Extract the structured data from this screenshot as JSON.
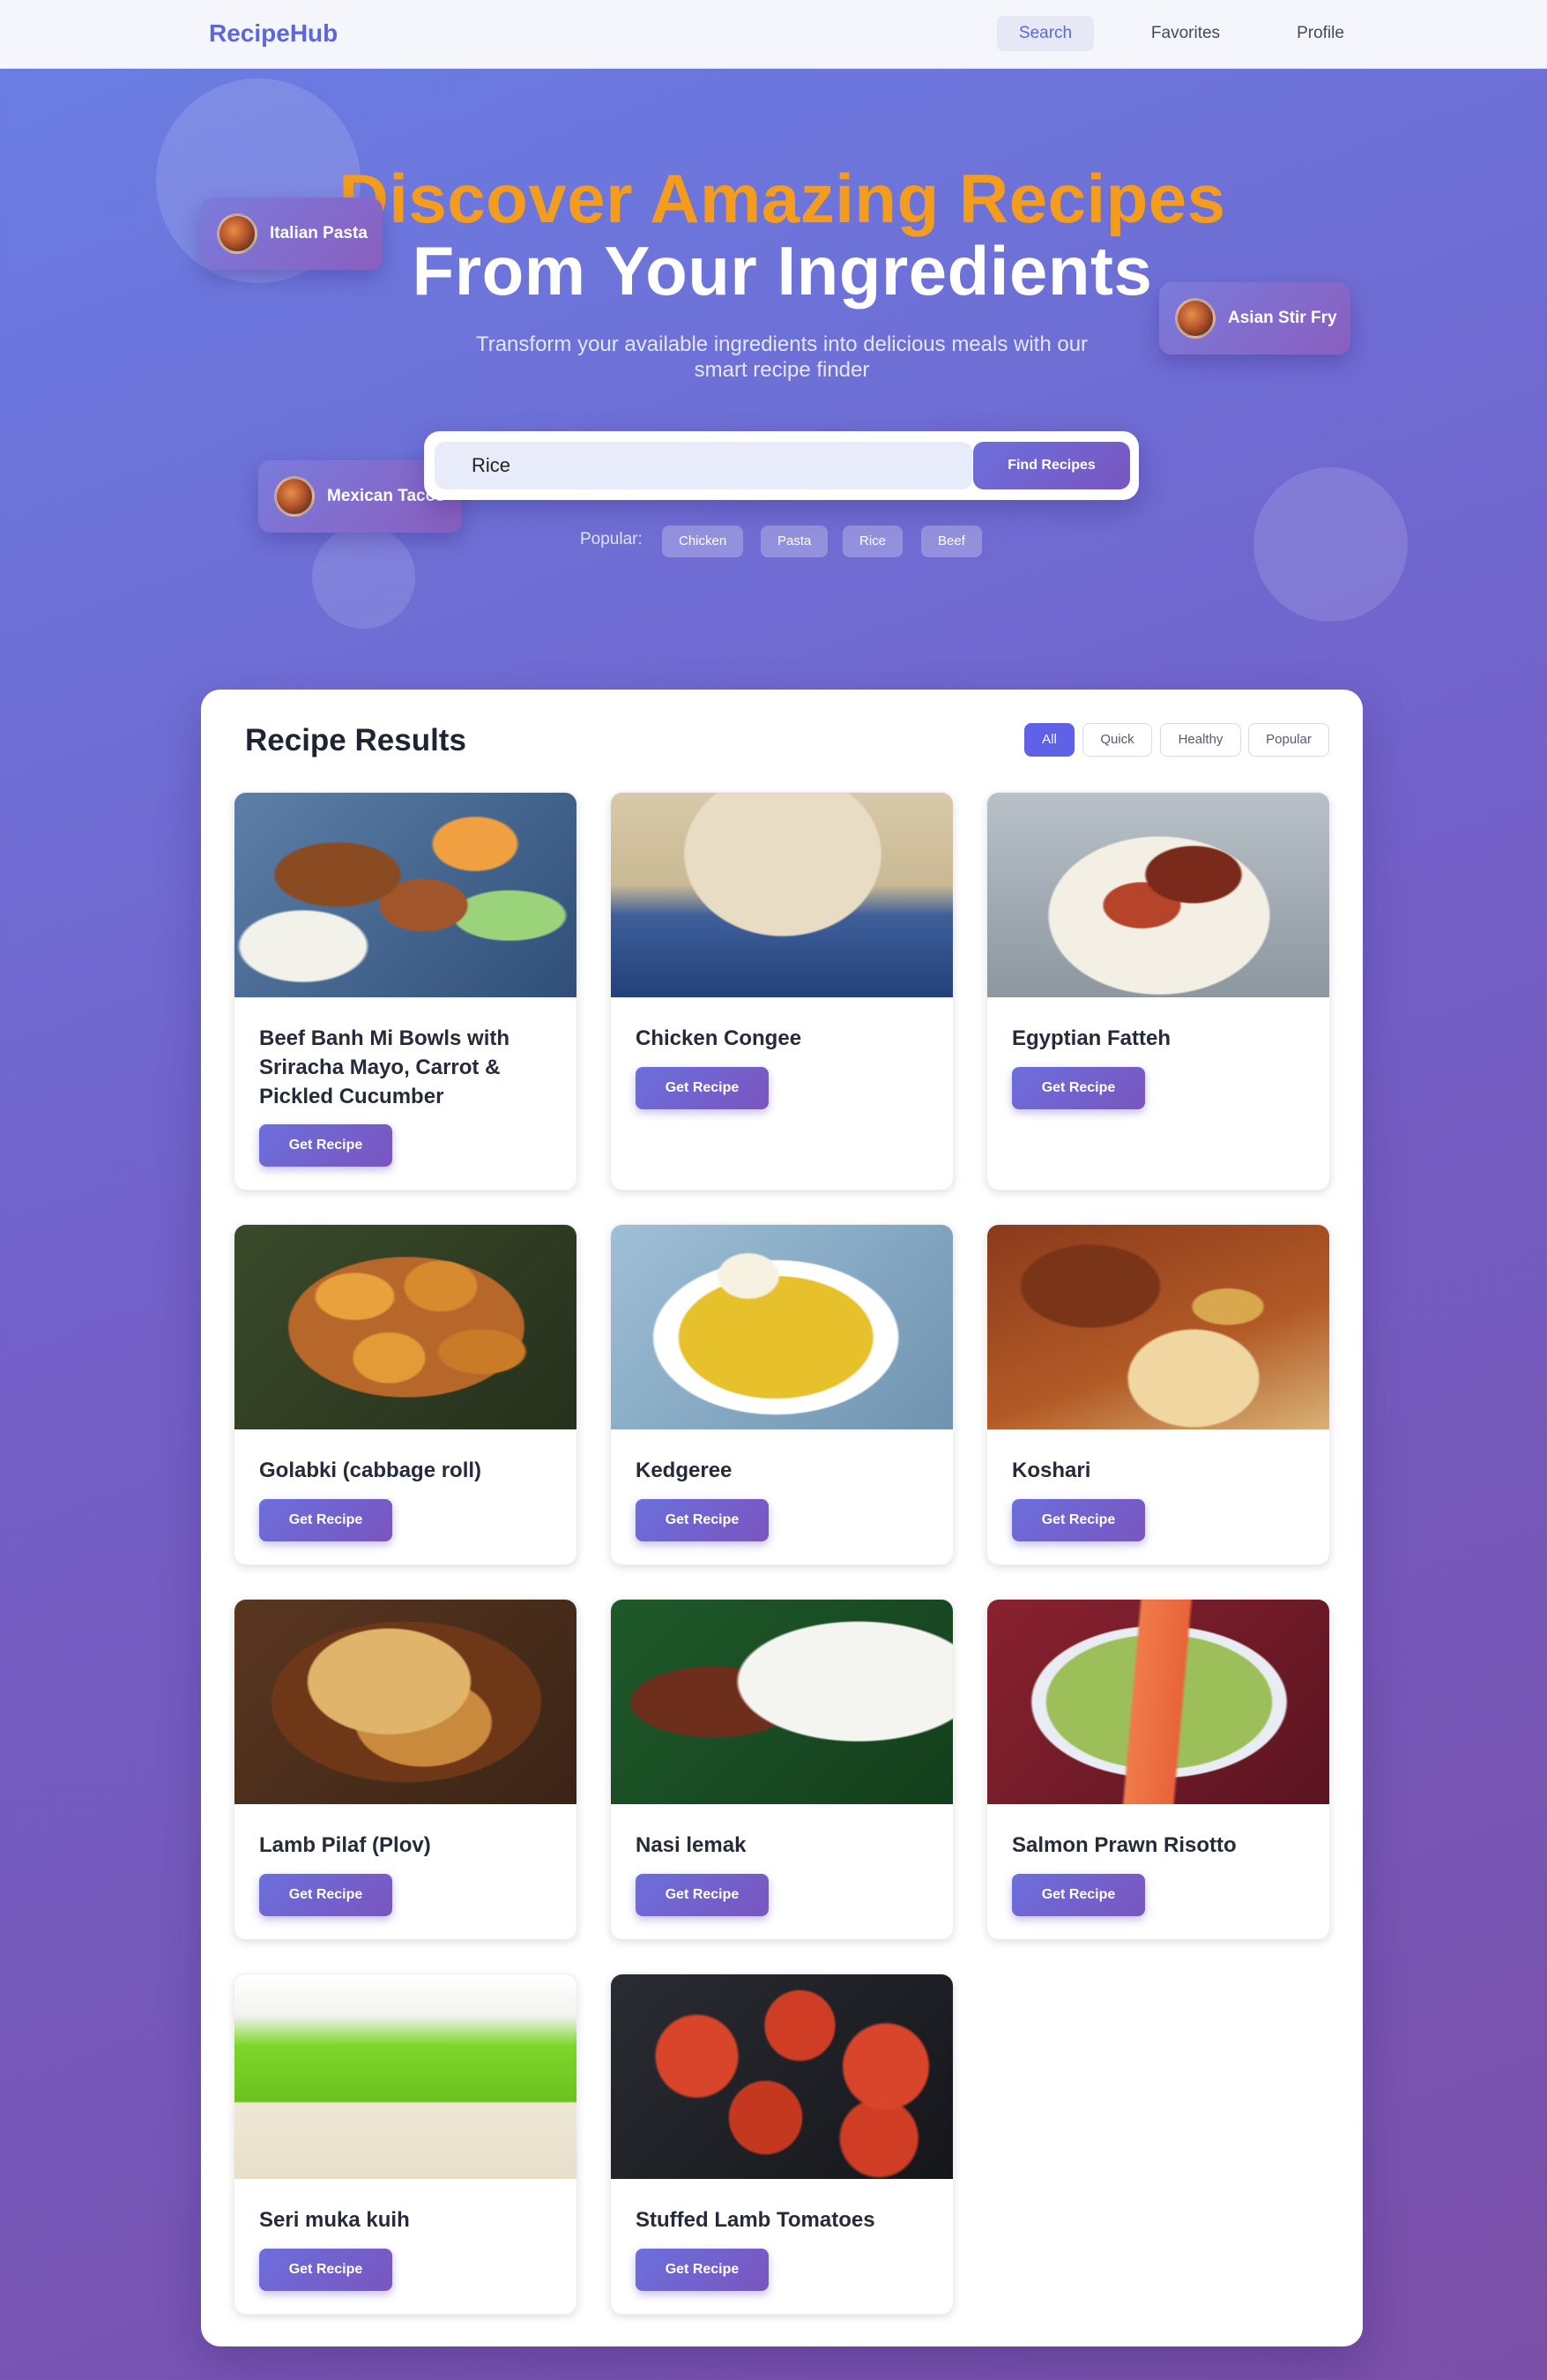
{
  "app": {
    "brand": "RecipeHub"
  },
  "nav": {
    "items": [
      {
        "label": "Search",
        "active": true
      },
      {
        "label": "Favorites",
        "active": false
      },
      {
        "label": "Profile",
        "active": false
      }
    ]
  },
  "hero": {
    "title_line1": "Discover Amazing Recipes",
    "title_line2": "From Your Ingredients",
    "subtitle": "Transform your available ingredients into delicious meals with our smart recipe finder",
    "floating_cards": [
      {
        "label": "Italian Pasta"
      },
      {
        "label": "Asian Stir Fry"
      },
      {
        "label": "Mexican Tacos"
      }
    ],
    "accent_color": "#f39c1e"
  },
  "search": {
    "value": "Rice",
    "button_label": "Find Recipes",
    "popular_label": "Popular:",
    "popular_chips": [
      "Chicken",
      "Pasta",
      "Rice",
      "Beef"
    ]
  },
  "results": {
    "title": "Recipe Results",
    "filters": [
      {
        "label": "All",
        "active": true
      },
      {
        "label": "Quick",
        "active": false
      },
      {
        "label": "Healthy",
        "active": false
      },
      {
        "label": "Popular",
        "active": false
      }
    ],
    "button_label": "Get Recipe",
    "recipes": [
      {
        "name": "Beef Banh Mi Bowls with Sriracha Mayo, Carrot & Pickled Cucumber"
      },
      {
        "name": "Chicken Congee"
      },
      {
        "name": "Egyptian Fatteh"
      },
      {
        "name": "Golabki (cabbage roll)"
      },
      {
        "name": "Kedgeree"
      },
      {
        "name": "Koshari"
      },
      {
        "name": "Lamb Pilaf (Plov)"
      },
      {
        "name": "Nasi lemak"
      },
      {
        "name": "Salmon Prawn Risotto"
      },
      {
        "name": "Seri muka kuih"
      },
      {
        "name": "Stuffed Lamb Tomatoes"
      }
    ]
  }
}
